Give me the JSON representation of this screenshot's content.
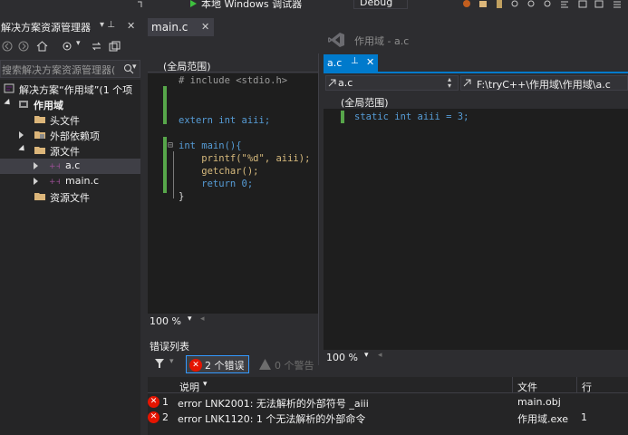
{
  "toolbar": {
    "debugger_label": "本地 Windows 调试器",
    "config_label": "Debug"
  },
  "solution_explorer": {
    "title": "解决方案资源管理器",
    "pin_glyph": "▾ ⊥",
    "close_glyph": "✕",
    "search_placeholder": "搜索解决方案资源管理器(",
    "tree": [
      {
        "label": "解决方案“作用域”(1 个项",
        "level": 0,
        "expanded": null,
        "icon": "solution-icon"
      },
      {
        "label": "作用域",
        "level": 1,
        "expanded": true,
        "icon": "project-icon",
        "bold": true
      },
      {
        "label": "头文件",
        "level": 2,
        "expanded": null,
        "icon": "folder-filter-icon"
      },
      {
        "label": "外部依赖项",
        "level": 2,
        "expanded": false,
        "icon": "external-deps-icon"
      },
      {
        "label": "源文件",
        "level": 2,
        "expanded": true,
        "icon": "folder-filter-icon"
      },
      {
        "label": "a.c",
        "level": 3,
        "expanded": false,
        "icon": "c-file-icon",
        "selected": true
      },
      {
        "label": "main.c",
        "level": 3,
        "expanded": false,
        "icon": "c-file-icon"
      },
      {
        "label": "资源文件",
        "level": 2,
        "expanded": null,
        "icon": "folder-filter-icon"
      }
    ]
  },
  "main_editor": {
    "tab_label": "main.c",
    "tab_close": "✕",
    "scope": "(全局范围)",
    "zoom": "100 %",
    "lines": [
      "# include <stdio.h>",
      "",
      "",
      "extern int aiii;",
      "",
      "int main(){",
      "    printf(\"%d\", aiii);",
      "    getchar();",
      "    return 0;",
      "}"
    ]
  },
  "ac_window": {
    "title": "作用域 - a.c",
    "tab_label": "a.c",
    "tab_pin": "⊥",
    "tab_close": "✕",
    "nav_left": "a.c",
    "nav_right": "F:\\tryC++\\作用域\\作用域\\a.c",
    "scope": "(全局范围)",
    "code_line": "static int aiii = 3;",
    "zoom": "100 %"
  },
  "error_list": {
    "title": "错误列表",
    "errors_button": "2 个错误",
    "warnings_button": "0 个警告",
    "columns": {
      "desc": "说明",
      "file": "文件",
      "line": "行"
    },
    "rows": [
      {
        "num": "1",
        "desc": "error LNK2001: 无法解析的外部符号 _aiii",
        "file": "main.obj",
        "line": ""
      },
      {
        "num": "2",
        "desc": "error LNK1120: 1 个无法解析的外部命令",
        "file": "作用域.exe",
        "line": "1"
      }
    ]
  },
  "colors": {
    "accent": "#007acc",
    "error": "#e51400",
    "code_background": "#1e1e1e",
    "chrome": "#2d2d30"
  }
}
